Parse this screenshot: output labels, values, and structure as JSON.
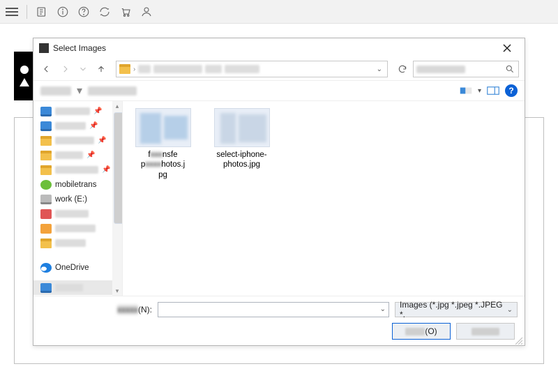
{
  "apptoolbar": {
    "icons": [
      "menu",
      "divider",
      "note",
      "info",
      "help",
      "sync",
      "cart",
      "user"
    ]
  },
  "dialog": {
    "title": "Select Images",
    "nav": {
      "back": "←",
      "forward": "→",
      "up": "↑"
    },
    "address": {
      "segments_blur_widths": [
        18,
        70,
        24,
        50
      ]
    },
    "search": {
      "placeholder_blur_width": 70
    },
    "cmdbar": {
      "left_blurs": [
        44,
        70
      ],
      "help": "?"
    },
    "sidebar": {
      "items": [
        {
          "icon": "monitor",
          "blur": 50,
          "pin": true
        },
        {
          "icon": "monitor",
          "blur": 44,
          "pin": true
        },
        {
          "icon": "folder",
          "blur": 56,
          "pin": true
        },
        {
          "icon": "folder",
          "blur": 40,
          "pin": true
        },
        {
          "icon": "folder",
          "blur": 62,
          "pin": true
        },
        {
          "icon": "green",
          "label": "mobiletrans",
          "pin": true
        },
        {
          "icon": "drive",
          "label": "work (E:)"
        },
        {
          "icon": "red",
          "blur": 48
        },
        {
          "icon": "orange",
          "blur": 58
        },
        {
          "icon": "folder",
          "blur": 44
        },
        {
          "icon": "",
          "spacer": true
        },
        {
          "icon": "cloud",
          "label": "OneDrive"
        },
        {
          "icon": "monitor",
          "blur": 40,
          "sel": true
        },
        {
          "icon": "drive",
          "blur": 30
        }
      ]
    },
    "files": [
      {
        "name": "f…-transfer-p…-photos.jpg",
        "caption_parts": [
          "f",
          "…",
          "…nsfe",
          "p",
          "…",
          "hotos.j",
          "pg"
        ]
      },
      {
        "name": "select-iphone-photos.jpg",
        "caption": "select-iphone-photos.jpg"
      }
    ],
    "footer": {
      "filename_label_suffix": "(N):",
      "filter_label": "Images (*.jpg *.jpeg *.JPEG *.",
      "open_suffix": "(O)"
    }
  }
}
